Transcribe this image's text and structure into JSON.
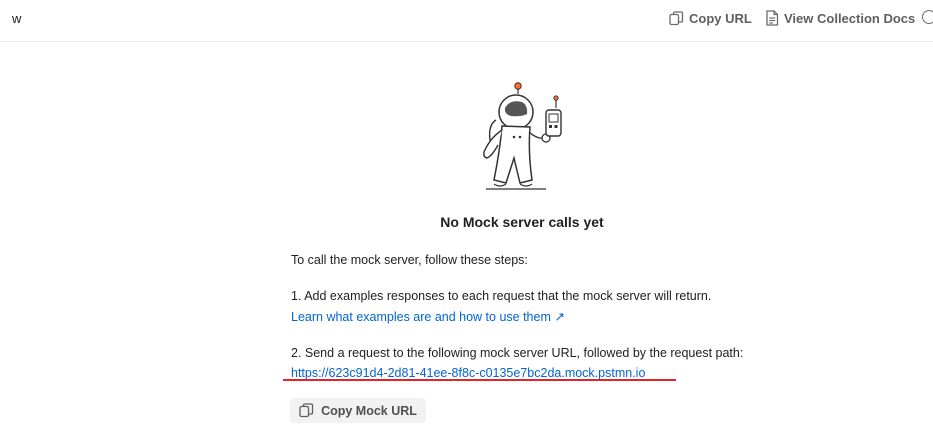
{
  "header": {
    "tab_title": "w",
    "copy_url_label": "Copy URL",
    "docs_label": "View Collection Docs"
  },
  "empty_state": {
    "title": "No Mock server calls yet",
    "intro": "To call the mock server, follow these steps:",
    "step1": "1. Add examples responses to each request that the mock server will return.",
    "learn_link": "Learn what examples are and how to use them ↗",
    "step2": "2. Send a request to the following mock server URL, followed by the request path:",
    "mock_url": "https://623c91d4-2d81-41ee-8f8c-c0135e7bc2da.mock.pstmn.io",
    "copy_mock_label": "Copy Mock URL"
  },
  "colors": {
    "link": "#0265d2",
    "annotation": "#e3242b"
  }
}
